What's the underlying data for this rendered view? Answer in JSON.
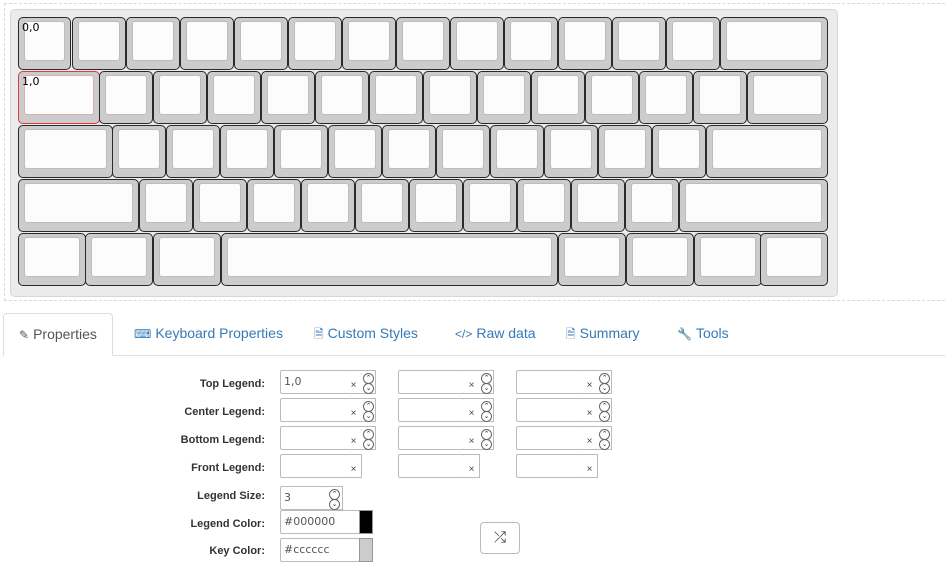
{
  "keyboard": {
    "key_color": "#cccccc",
    "selected_border": "#e03a3a",
    "legends": {
      "first_key": "0,0",
      "selected_key": "1,0"
    }
  },
  "tabs": [
    {
      "label": "Properties",
      "icon": "edit-icon",
      "active": true
    },
    {
      "label": "Keyboard Properties",
      "icon": "keyboard-icon",
      "active": false
    },
    {
      "label": "Custom Styles",
      "icon": "file-icon",
      "active": false
    },
    {
      "label": "Raw data",
      "icon": "code-icon",
      "active": false
    },
    {
      "label": "Summary",
      "icon": "file-icon",
      "active": false
    },
    {
      "label": "Tools",
      "icon": "wrench-icon",
      "active": false
    }
  ],
  "properties": {
    "top_legend_label": "Top Legend:",
    "center_legend_label": "Center Legend:",
    "bottom_legend_label": "Bottom Legend:",
    "front_legend_label": "Front Legend:",
    "legend_size_label": "Legend Size:",
    "legend_color_label": "Legend Color:",
    "key_color_label": "Key Color:",
    "top_legend_value": "1,0",
    "legend_size_value": "3",
    "legend_color_value": "#000000",
    "key_color_value": "#cccccc",
    "clear_glyph": "×"
  }
}
